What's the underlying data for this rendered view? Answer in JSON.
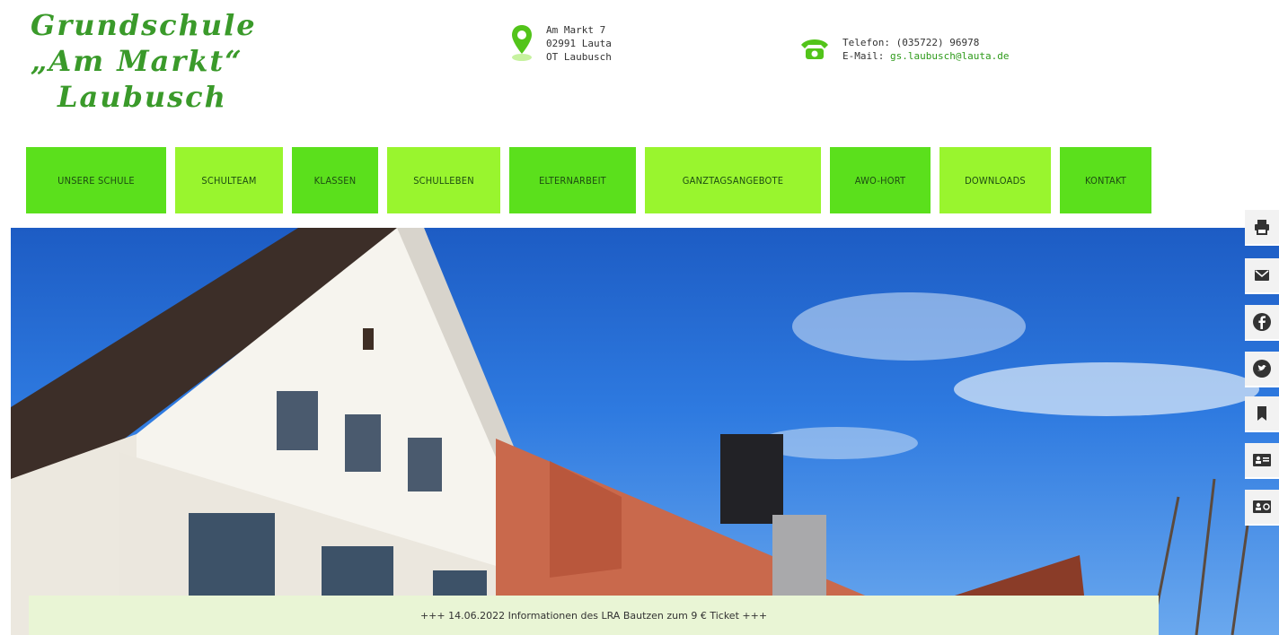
{
  "logo": {
    "line1": "Grundschule",
    "line2": "„Am Markt“",
    "line3": "Laubusch"
  },
  "address": {
    "icon": "location-pin-icon",
    "street": "Am Markt 7",
    "city": "02991 Lauta",
    "district": "OT Laubusch"
  },
  "contact": {
    "icon": "telephone-icon",
    "phone": "Telefon: (035722) 96978",
    "email_label": "E-Mail:",
    "email": "gs.laubusch@lauta.de"
  },
  "nav": {
    "items": [
      {
        "label": "UNSERE SCHULE"
      },
      {
        "label": "SCHULTEAM"
      },
      {
        "label": "KLASSEN"
      },
      {
        "label": "SCHULLEBEN"
      },
      {
        "label": "ELTERNARBEIT"
      },
      {
        "label": "GANZTAGSANGEBOTE"
      },
      {
        "label": "AWO-HORT"
      },
      {
        "label": "DOWNLOADS"
      },
      {
        "label": "KONTAKT"
      }
    ]
  },
  "ticker": {
    "text": "+++  14.06.2022 Informationen des LRA Bautzen zum 9 € Ticket  +++"
  },
  "share": [
    "print-icon",
    "mail-icon",
    "facebook-icon",
    "twitter-icon",
    "bookmark-icon",
    "vcard-icon",
    "contact-card-icon"
  ],
  "colors": {
    "green_dark": "#5be01c",
    "green_light": "#99f52e",
    "logo_green": "#3a9a2a"
  }
}
